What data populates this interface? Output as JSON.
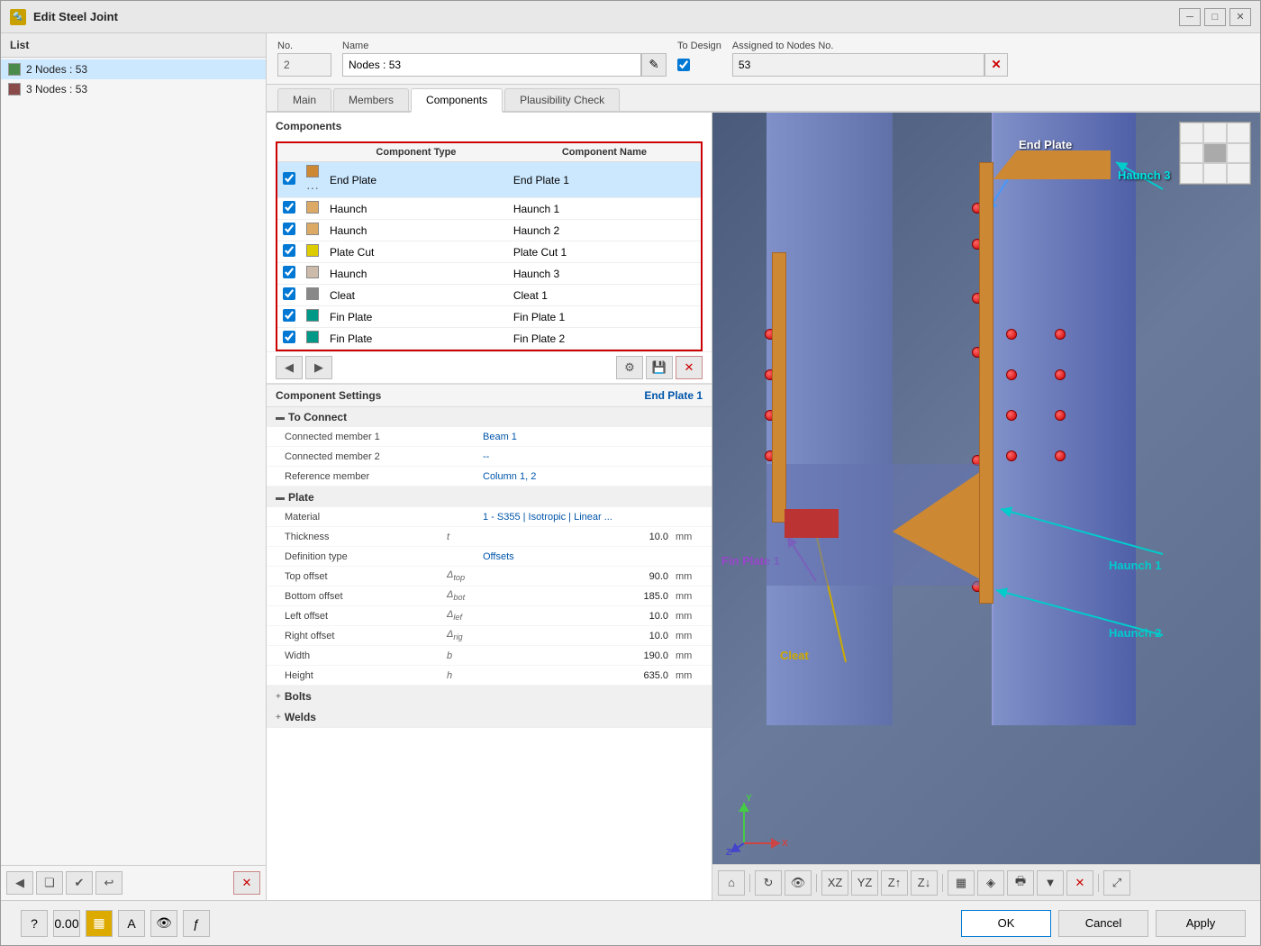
{
  "window": {
    "title": "Edit Steel Joint",
    "icon": "🔩"
  },
  "header": {
    "no_label": "No.",
    "no_value": "2",
    "name_label": "Name",
    "name_value": "Nodes : 53",
    "to_design_label": "To Design",
    "assigned_label": "Assigned to Nodes No.",
    "assigned_value": "53"
  },
  "tabs": [
    {
      "id": "main",
      "label": "Main"
    },
    {
      "id": "members",
      "label": "Members"
    },
    {
      "id": "components",
      "label": "Components"
    },
    {
      "id": "plausibility",
      "label": "Plausibility Check"
    }
  ],
  "components_section": {
    "title": "Components",
    "col_type": "Component Type",
    "col_name": "Component Name",
    "rows": [
      {
        "checked": true,
        "color": "#cc8833",
        "type": "End Plate",
        "name": "End Plate 1",
        "selected": true
      },
      {
        "checked": true,
        "color": "#ddaa66",
        "type": "Haunch",
        "name": "Haunch 1",
        "selected": false
      },
      {
        "checked": true,
        "color": "#ddaa66",
        "type": "Haunch",
        "name": "Haunch 2",
        "selected": false
      },
      {
        "checked": true,
        "color": "#ddcc00",
        "type": "Plate Cut",
        "name": "Plate Cut 1",
        "selected": false
      },
      {
        "checked": true,
        "color": "#ccbbaa",
        "type": "Haunch",
        "name": "Haunch 3",
        "selected": false
      },
      {
        "checked": true,
        "color": "#888888",
        "type": "Cleat",
        "name": "Cleat 1",
        "selected": false
      },
      {
        "checked": true,
        "color": "#009988",
        "type": "Fin Plate",
        "name": "Fin Plate 1",
        "selected": false
      },
      {
        "checked": true,
        "color": "#009988",
        "type": "Fin Plate",
        "name": "Fin Plate 2",
        "selected": false
      }
    ]
  },
  "component_settings": {
    "title": "Component Settings",
    "current": "End Plate 1",
    "groups": [
      {
        "id": "to_connect",
        "label": "To Connect",
        "collapsed": false,
        "rows": [
          {
            "label": "Connected member 1",
            "symbol": "",
            "value": "Beam 1",
            "unit": ""
          },
          {
            "label": "Connected member 2",
            "symbol": "",
            "value": "--",
            "unit": ""
          },
          {
            "label": "Reference member",
            "symbol": "",
            "value": "Column 1, 2",
            "unit": ""
          }
        ]
      },
      {
        "id": "plate",
        "label": "Plate",
        "collapsed": false,
        "rows": [
          {
            "label": "Material",
            "symbol": "",
            "value": "1 - S355 | Isotropic | Linear ...",
            "unit": "",
            "is_link": true
          },
          {
            "label": "Thickness",
            "symbol": "t",
            "value": "10.0",
            "unit": "mm"
          },
          {
            "label": "Definition type",
            "symbol": "",
            "value": "Offsets",
            "unit": ""
          },
          {
            "label": "Top offset",
            "symbol": "Δtop",
            "value": "90.0",
            "unit": "mm"
          },
          {
            "label": "Bottom offset",
            "symbol": "Δbot",
            "value": "185.0",
            "unit": "mm"
          },
          {
            "label": "Left offset",
            "symbol": "Δlef",
            "value": "10.0",
            "unit": "mm"
          },
          {
            "label": "Right offset",
            "symbol": "Δrig",
            "value": "10.0",
            "unit": "mm"
          },
          {
            "label": "Width",
            "symbol": "b",
            "value": "190.0",
            "unit": "mm"
          },
          {
            "label": "Height",
            "symbol": "h",
            "value": "635.0",
            "unit": "mm"
          }
        ]
      },
      {
        "id": "bolts",
        "label": "Bolts",
        "collapsed": true,
        "rows": []
      },
      {
        "id": "welds",
        "label": "Welds",
        "collapsed": true,
        "rows": []
      }
    ]
  },
  "viz_labels": {
    "end_plate": "End Plate",
    "haunch3": "Haunch 3",
    "haunch1": "Haunch 1",
    "haunch2": "Haunch 2",
    "fin_plate1": "Fin Plate 1",
    "cleat": "Cleat"
  },
  "footer": {
    "ok": "OK",
    "cancel": "Cancel",
    "apply": "Apply"
  },
  "list": {
    "label": "List",
    "items": [
      {
        "id": 2,
        "label": "2  Nodes : 53",
        "color": "#4a8a4a",
        "selected": true
      },
      {
        "id": 3,
        "label": "3  Nodes : 53",
        "color": "#8a4a4a",
        "selected": false
      }
    ]
  }
}
